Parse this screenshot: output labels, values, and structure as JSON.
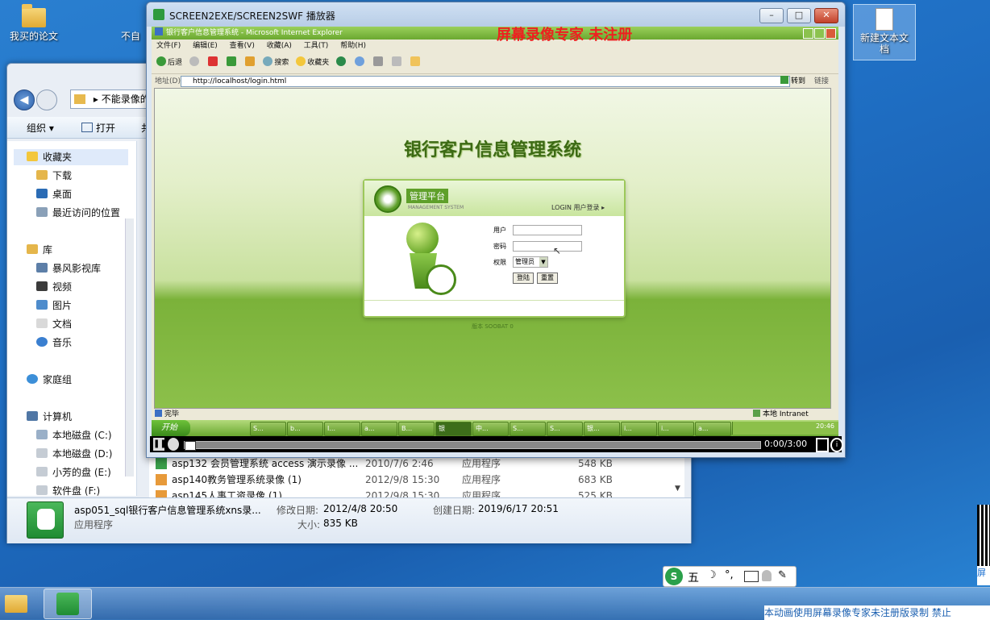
{
  "desktop": {
    "icons": [
      {
        "label": "我买的论文"
      },
      {
        "label": "不自"
      },
      {
        "label": "新建文本文档"
      }
    ]
  },
  "explorer": {
    "breadcrumb": "不能录像的",
    "toolbar": {
      "organize": "组织 ▾",
      "open": "打开",
      "more": "共"
    },
    "nav": {
      "favorites": "收藏夹",
      "downloads": "下载",
      "desktop": "桌面",
      "recent": "最近访问的位置",
      "libraries": "库",
      "storm": "暴风影视库",
      "videos": "视频",
      "pictures": "图片",
      "documents": "文档",
      "music": "音乐",
      "homegroup": "家庭组",
      "computer": "计算机",
      "disk_c": "本地磁盘 (C:)",
      "disk_d": "本地磁盘 (D:)",
      "disk_e": "小芳的盘 (E:)",
      "disk_f": "软件盘 (F:)"
    },
    "files": [
      {
        "name": "asp132 会员管理系统 access 演示录像 ...",
        "date": "2010/7/6 2:46",
        "type": "应用程序",
        "size": "548 KB"
      },
      {
        "name": "asp140教务管理系统录像 (1)",
        "date": "2012/9/8 15:30",
        "type": "应用程序",
        "size": "683 KB"
      },
      {
        "name": "asp145人事工资录像 (1)",
        "date": "2012/9/8 15:30",
        "type": "应用程序",
        "size": "525 KB"
      }
    ],
    "details": {
      "name": "asp051_sql银行客户信息管理系统xns录...",
      "kind": "应用程序",
      "modified_label": "修改日期:",
      "modified": "2012/4/8 20:50",
      "created_label": "创建日期:",
      "created": "2019/6/17 20:51",
      "size_label": "大小:",
      "size": "835 KB"
    }
  },
  "player": {
    "title": "SCREEN2EXE/SCREEN2SWF 播放器",
    "watermark": "屏幕录像专家  未注册",
    "time": "0:00/3:00",
    "progress": 0.0
  },
  "ie": {
    "title": "银行客户信息管理系统 - Microsoft Internet Explorer",
    "menu": [
      "文件(F)",
      "编辑(E)",
      "查看(V)",
      "收藏(A)",
      "工具(T)",
      "帮助(H)"
    ],
    "toolbar": {
      "back": "后退",
      "search": "搜索",
      "favorites": "收藏夹"
    },
    "address_label": "地址(D)",
    "url": "http://localhost/login.html",
    "go": "转到",
    "links": "链接",
    "status_left": "完毕",
    "status_right": "本地 Intranet",
    "tasks": [
      "开始",
      "S...",
      "b...",
      "I...",
      "a...",
      "B...",
      "银",
      "中...",
      "S...",
      "S...",
      "银...",
      "i...",
      "i...",
      "a..."
    ],
    "clock": "20:46"
  },
  "login": {
    "system_title": "银行客户信息管理系统",
    "platform": "管理平台",
    "platform_en": "MANAGEMENT SYSTEM",
    "login_link": "LOGIN 用户登录 ▸",
    "user_label": "用户",
    "password_label": "密码",
    "role_label": "权限",
    "role_value": "管理员",
    "submit": "登陆",
    "reset": "重置",
    "version": "版本 SOOBAT 0"
  },
  "taskbar": {
    "ime": {
      "mode": "五"
    },
    "marquee": "本动画使用屏幕录像专家未注册版录制  禁止"
  },
  "side_qr": {
    "label": "屏"
  }
}
